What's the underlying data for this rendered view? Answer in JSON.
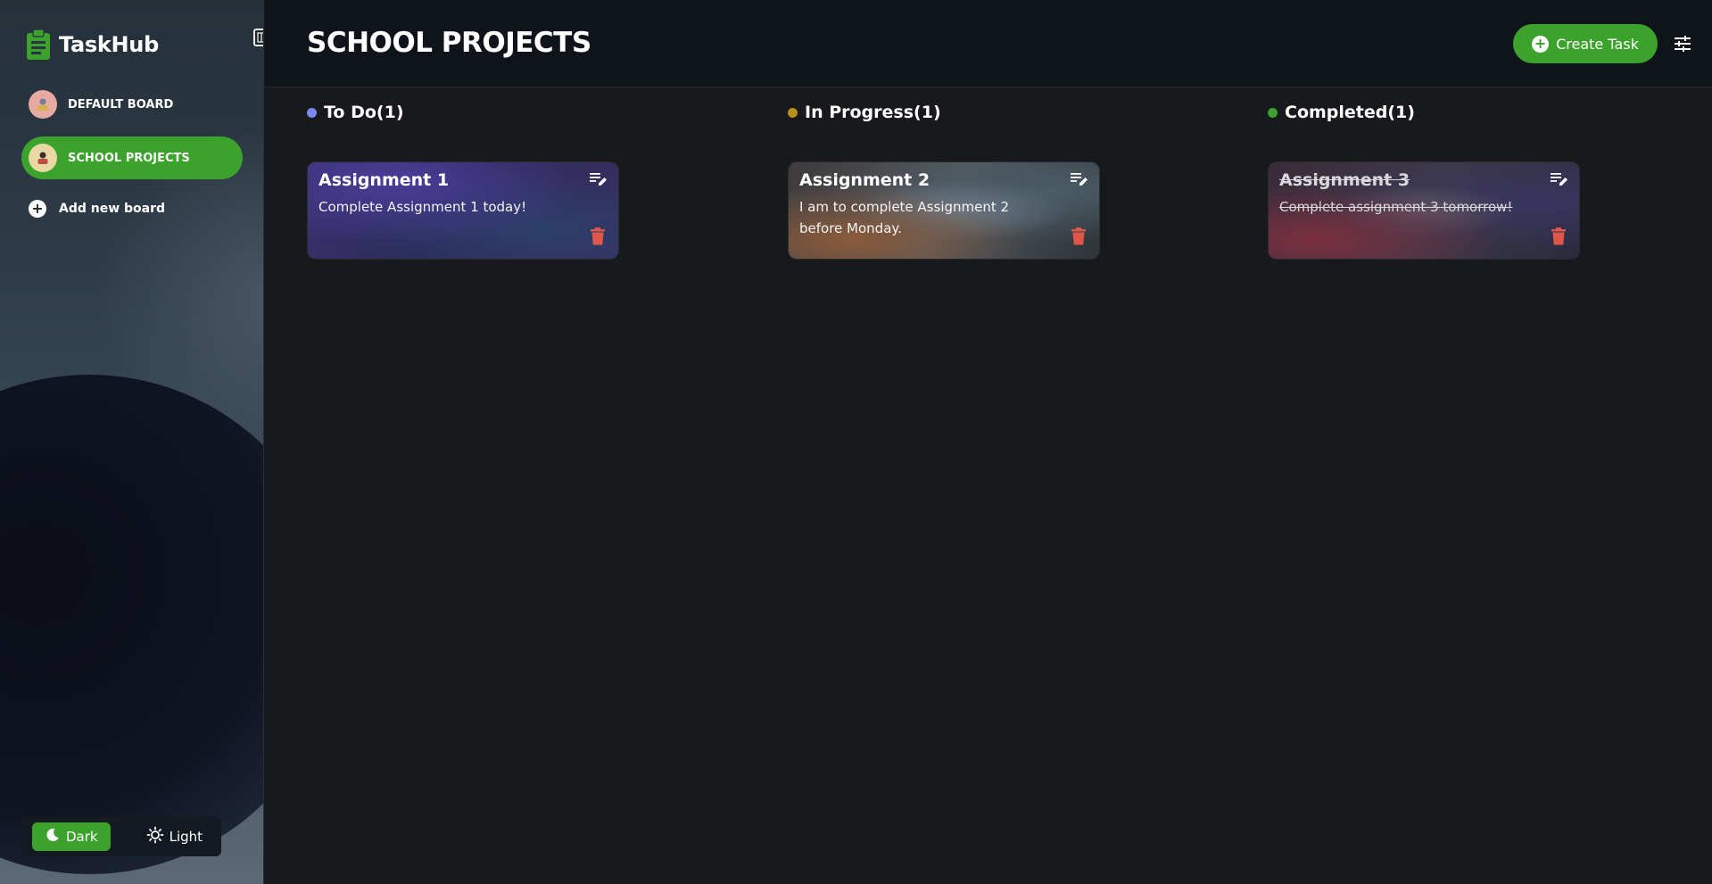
{
  "app": {
    "name": "TaskHub"
  },
  "sidebar": {
    "boards": [
      {
        "label": "DEFAULT BOARD",
        "active": false,
        "avatar_icon": "person-avatar"
      },
      {
        "label": "SCHOOL PROJECTS",
        "active": true,
        "avatar_icon": "person-avatar"
      }
    ],
    "add_board_label": "Add new board",
    "theme": {
      "dark_label": "Dark",
      "light_label": "Light",
      "selected": "Dark"
    }
  },
  "header": {
    "title": "SCHOOL PROJECTS",
    "create_label": "Create Task"
  },
  "columns": [
    {
      "label": "To Do(1)",
      "dot_color": "#7b88f0",
      "cards": [
        {
          "title": "Assignment 1",
          "description": "Complete Assignment 1 today!",
          "completed": false
        }
      ]
    },
    {
      "label": "In Progress(1)",
      "dot_color": "#b8901c",
      "cards": [
        {
          "title": "Assignment 2",
          "description": "I am to complete Assignment 2 before Monday.",
          "completed": false
        }
      ]
    },
    {
      "label": "Completed(1)",
      "dot_color": "#3ba22c",
      "cards": [
        {
          "title": "Assignment 3",
          "description": "Complete assignment 3 tomorrow!",
          "completed": true
        }
      ]
    }
  ],
  "colors": {
    "accent": "#3ba22c",
    "delete": "#e0574a",
    "background": "#18191c"
  }
}
